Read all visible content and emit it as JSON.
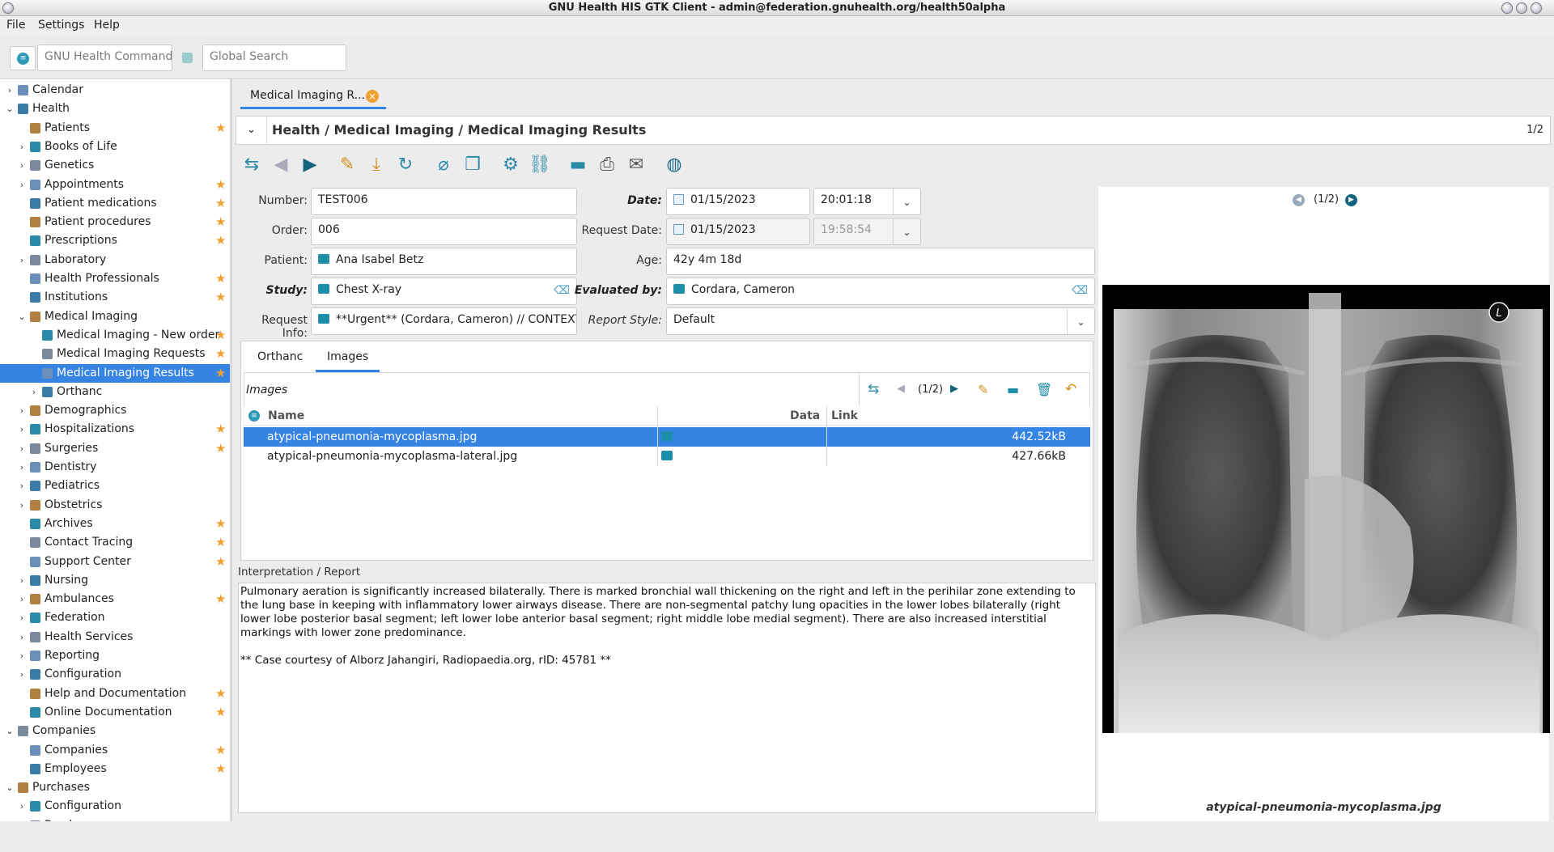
{
  "window": {
    "title": "GNU Health HIS GTK Client - admin@federation.gnuhealth.org/health50alpha"
  },
  "menu": [
    "File",
    "Settings",
    "Help"
  ],
  "command": {
    "placeholder": "GNU Health Command"
  },
  "search": {
    "placeholder": "Global Search"
  },
  "sidebar": {
    "items": [
      {
        "label": "Calendar",
        "level": 0,
        "arrow": "right",
        "star": false
      },
      {
        "label": "Health",
        "level": 0,
        "arrow": "down",
        "star": false
      },
      {
        "label": "Patients",
        "level": 1,
        "arrow": "",
        "star": true
      },
      {
        "label": "Books of Life",
        "level": 1,
        "arrow": "right",
        "star": false
      },
      {
        "label": "Genetics",
        "level": 1,
        "arrow": "right",
        "star": false
      },
      {
        "label": "Appointments",
        "level": 1,
        "arrow": "right",
        "star": true
      },
      {
        "label": "Patient medications",
        "level": 1,
        "arrow": "",
        "star": true
      },
      {
        "label": "Patient procedures",
        "level": 1,
        "arrow": "",
        "star": true
      },
      {
        "label": "Prescriptions",
        "level": 1,
        "arrow": "",
        "star": true
      },
      {
        "label": "Laboratory",
        "level": 1,
        "arrow": "right",
        "star": false
      },
      {
        "label": "Health Professionals",
        "level": 1,
        "arrow": "",
        "star": true
      },
      {
        "label": "Institutions",
        "level": 1,
        "arrow": "",
        "star": true
      },
      {
        "label": "Medical Imaging",
        "level": 1,
        "arrow": "down",
        "star": false
      },
      {
        "label": "Medical Imaging - New order",
        "level": 2,
        "arrow": "",
        "star": true
      },
      {
        "label": "Medical Imaging Requests",
        "level": 2,
        "arrow": "",
        "star": true
      },
      {
        "label": "Medical Imaging Results",
        "level": 2,
        "arrow": "",
        "star": true,
        "selected": true
      },
      {
        "label": "Orthanc",
        "level": 2,
        "arrow": "right",
        "star": false
      },
      {
        "label": "Demographics",
        "level": 1,
        "arrow": "right",
        "star": false
      },
      {
        "label": "Hospitalizations",
        "level": 1,
        "arrow": "right",
        "star": true
      },
      {
        "label": "Surgeries",
        "level": 1,
        "arrow": "right",
        "star": true
      },
      {
        "label": "Dentistry",
        "level": 1,
        "arrow": "right",
        "star": false
      },
      {
        "label": "Pediatrics",
        "level": 1,
        "arrow": "right",
        "star": false
      },
      {
        "label": "Obstetrics",
        "level": 1,
        "arrow": "right",
        "star": false
      },
      {
        "label": "Archives",
        "level": 1,
        "arrow": "",
        "star": true
      },
      {
        "label": "Contact Tracing",
        "level": 1,
        "arrow": "",
        "star": true
      },
      {
        "label": "Support Center",
        "level": 1,
        "arrow": "",
        "star": true
      },
      {
        "label": "Nursing",
        "level": 1,
        "arrow": "right",
        "star": false
      },
      {
        "label": "Ambulances",
        "level": 1,
        "arrow": "right",
        "star": true
      },
      {
        "label": "Federation",
        "level": 1,
        "arrow": "right",
        "star": false
      },
      {
        "label": "Health Services",
        "level": 1,
        "arrow": "right",
        "star": false
      },
      {
        "label": "Reporting",
        "level": 1,
        "arrow": "right",
        "star": false
      },
      {
        "label": "Configuration",
        "level": 1,
        "arrow": "right",
        "star": false
      },
      {
        "label": "Help and Documentation",
        "level": 1,
        "arrow": "",
        "star": true
      },
      {
        "label": "Online Documentation",
        "level": 1,
        "arrow": "",
        "star": true
      },
      {
        "label": "Companies",
        "level": 0,
        "arrow": "down",
        "star": false
      },
      {
        "label": "Companies",
        "level": 1,
        "arrow": "",
        "star": true
      },
      {
        "label": "Employees",
        "level": 1,
        "arrow": "",
        "star": true
      },
      {
        "label": "Purchases",
        "level": 0,
        "arrow": "down",
        "star": false
      },
      {
        "label": "Configuration",
        "level": 1,
        "arrow": "right",
        "star": false
      },
      {
        "label": "Purchases",
        "level": 1,
        "arrow": "",
        "star": true
      }
    ]
  },
  "doc_tab": {
    "label": "Medical Imaging R..."
  },
  "header": {
    "breadcrumb": "Health / Medical Imaging / Medical Imaging Results",
    "record_count": "1/2"
  },
  "form": {
    "number_label": "Number:",
    "number": "TEST006",
    "order_label": "Order:",
    "order": "006",
    "patient_label": "Patient:",
    "patient": "Ana Isabel Betz",
    "study_label": "Study:",
    "study": "Chest X-ray",
    "request_info_label": "Request Info:",
    "request_info": "**Urgent** (Cordara, Cameron) // CONTEXT:",
    "date_label": "Date:",
    "date": "01/15/2023",
    "time": "20:01:18",
    "request_date_label": "Request Date:",
    "request_date": "01/15/2023",
    "request_time": "19:58:54",
    "age_label": "Age:",
    "age": "42y 4m 18d",
    "evaluated_by_label": "Evaluated by:",
    "evaluated_by": "Cordara, Cameron",
    "report_style_label": "Report Style:",
    "report_style": "Default"
  },
  "notebook": {
    "tabs": [
      "Orthanc",
      "Images"
    ],
    "active": "Images"
  },
  "images": {
    "title": "Images",
    "pager": "(1/2)",
    "columns": [
      "Name",
      "Data",
      "Link"
    ],
    "rows": [
      {
        "name": "atypical-pneumonia-mycoplasma.jpg",
        "data": "442.52kB",
        "link": "",
        "selected": true
      },
      {
        "name": "atypical-pneumonia-mycoplasma-lateral.jpg",
        "data": "427.66kB",
        "link": "",
        "selected": false
      }
    ]
  },
  "report": {
    "label": "Interpretation / Report",
    "text": "Pulmonary aeration is significantly increased bilaterally. There is marked bronchial wall thickening on the right and left in the perihilar zone extending to the lung base in keeping with inflammatory lower airways disease. There are non-segmental patchy lung opacities in the lower lobes bilaterally (right lower lobe posterior basal segment; left lower lobe anterior basal segment; right middle lobe medial segment). There are also increased interstitial markings with lower zone predominance.\n\n** Case courtesy of Alborz Jahangiri, Radiopaedia.org, rID: 45781 **"
  },
  "preview": {
    "pager": "(1/2)",
    "caption": "atypical-pneumonia-mycoplasma.jpg",
    "marker": "L"
  }
}
